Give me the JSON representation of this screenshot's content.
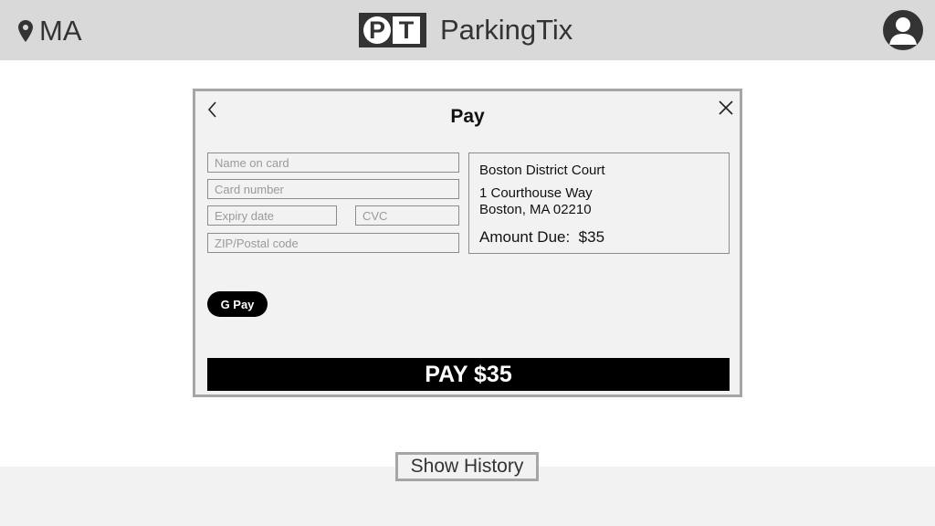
{
  "header": {
    "location": "MA",
    "logo_letters": [
      "P",
      "T"
    ],
    "app_name": "ParkingTix",
    "location_icon": "map-pin-icon",
    "profile_icon": "user-avatar-icon"
  },
  "modal": {
    "title": "Pay",
    "back_icon": "chevron-left-icon",
    "close_icon": "close-icon",
    "form": {
      "name_on_card": {
        "value": "",
        "placeholder": "Name on card"
      },
      "card_number": {
        "value": "",
        "placeholder": "Card number"
      },
      "expiry_date": {
        "value": "",
        "placeholder": "Expiry date"
      },
      "cvc": {
        "value": "",
        "placeholder": "CVC"
      },
      "zip": {
        "value": "",
        "placeholder": "ZIP/Postal code"
      }
    },
    "summary": {
      "court": "Boston District Court",
      "address_line1": "1 Courthouse Way",
      "address_line2": "Boston, MA 02210",
      "amount_due": "Amount Due:  $35"
    },
    "gpay_label": "G Pay",
    "pay_label": "PAY $35"
  },
  "footer": {
    "history_label": "Show History"
  },
  "colors": {
    "header_bg": "#d9d9d9",
    "modal_bg": "#f2f2f2",
    "primary_button": "#000000",
    "border": "#a6a6a6"
  }
}
